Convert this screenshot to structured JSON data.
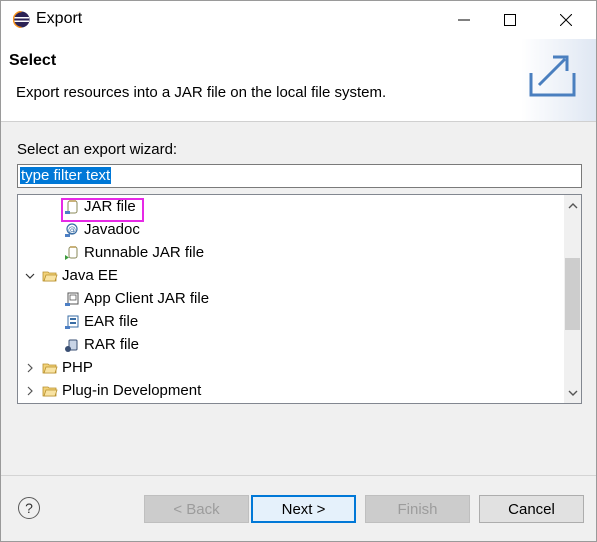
{
  "window": {
    "title": "Export",
    "accent": "#0078d7"
  },
  "banner": {
    "title": "Select",
    "description": "Export resources into a JAR file on the local file system."
  },
  "wizard": {
    "label": "Select an export wizard:",
    "filter_value": "type filter text"
  },
  "tree": {
    "items": [
      {
        "label": "JAR file",
        "icon": "jar-file-icon",
        "level": 2,
        "highlighted": true
      },
      {
        "label": "Javadoc",
        "icon": "javadoc-icon",
        "level": 2
      },
      {
        "label": "Runnable JAR file",
        "icon": "runnable-jar-icon",
        "level": 2
      },
      {
        "label": "Java EE",
        "icon": "folder-open-icon",
        "level": 1,
        "expanded": true
      },
      {
        "label": "App Client JAR file",
        "icon": "app-client-jar-icon",
        "level": 2
      },
      {
        "label": "EAR file",
        "icon": "ear-file-icon",
        "level": 2
      },
      {
        "label": "RAR file",
        "icon": "rar-file-icon",
        "level": 2
      },
      {
        "label": "PHP",
        "icon": "folder-icon",
        "level": 1,
        "expanded": false
      },
      {
        "label": "Plug-in Development",
        "icon": "folder-icon",
        "level": 1,
        "expanded": false
      }
    ],
    "highlight_color": "#e629e6"
  },
  "buttons": {
    "back": "< Back",
    "next": "Next >",
    "finish": "Finish",
    "cancel": "Cancel",
    "help": "?"
  }
}
